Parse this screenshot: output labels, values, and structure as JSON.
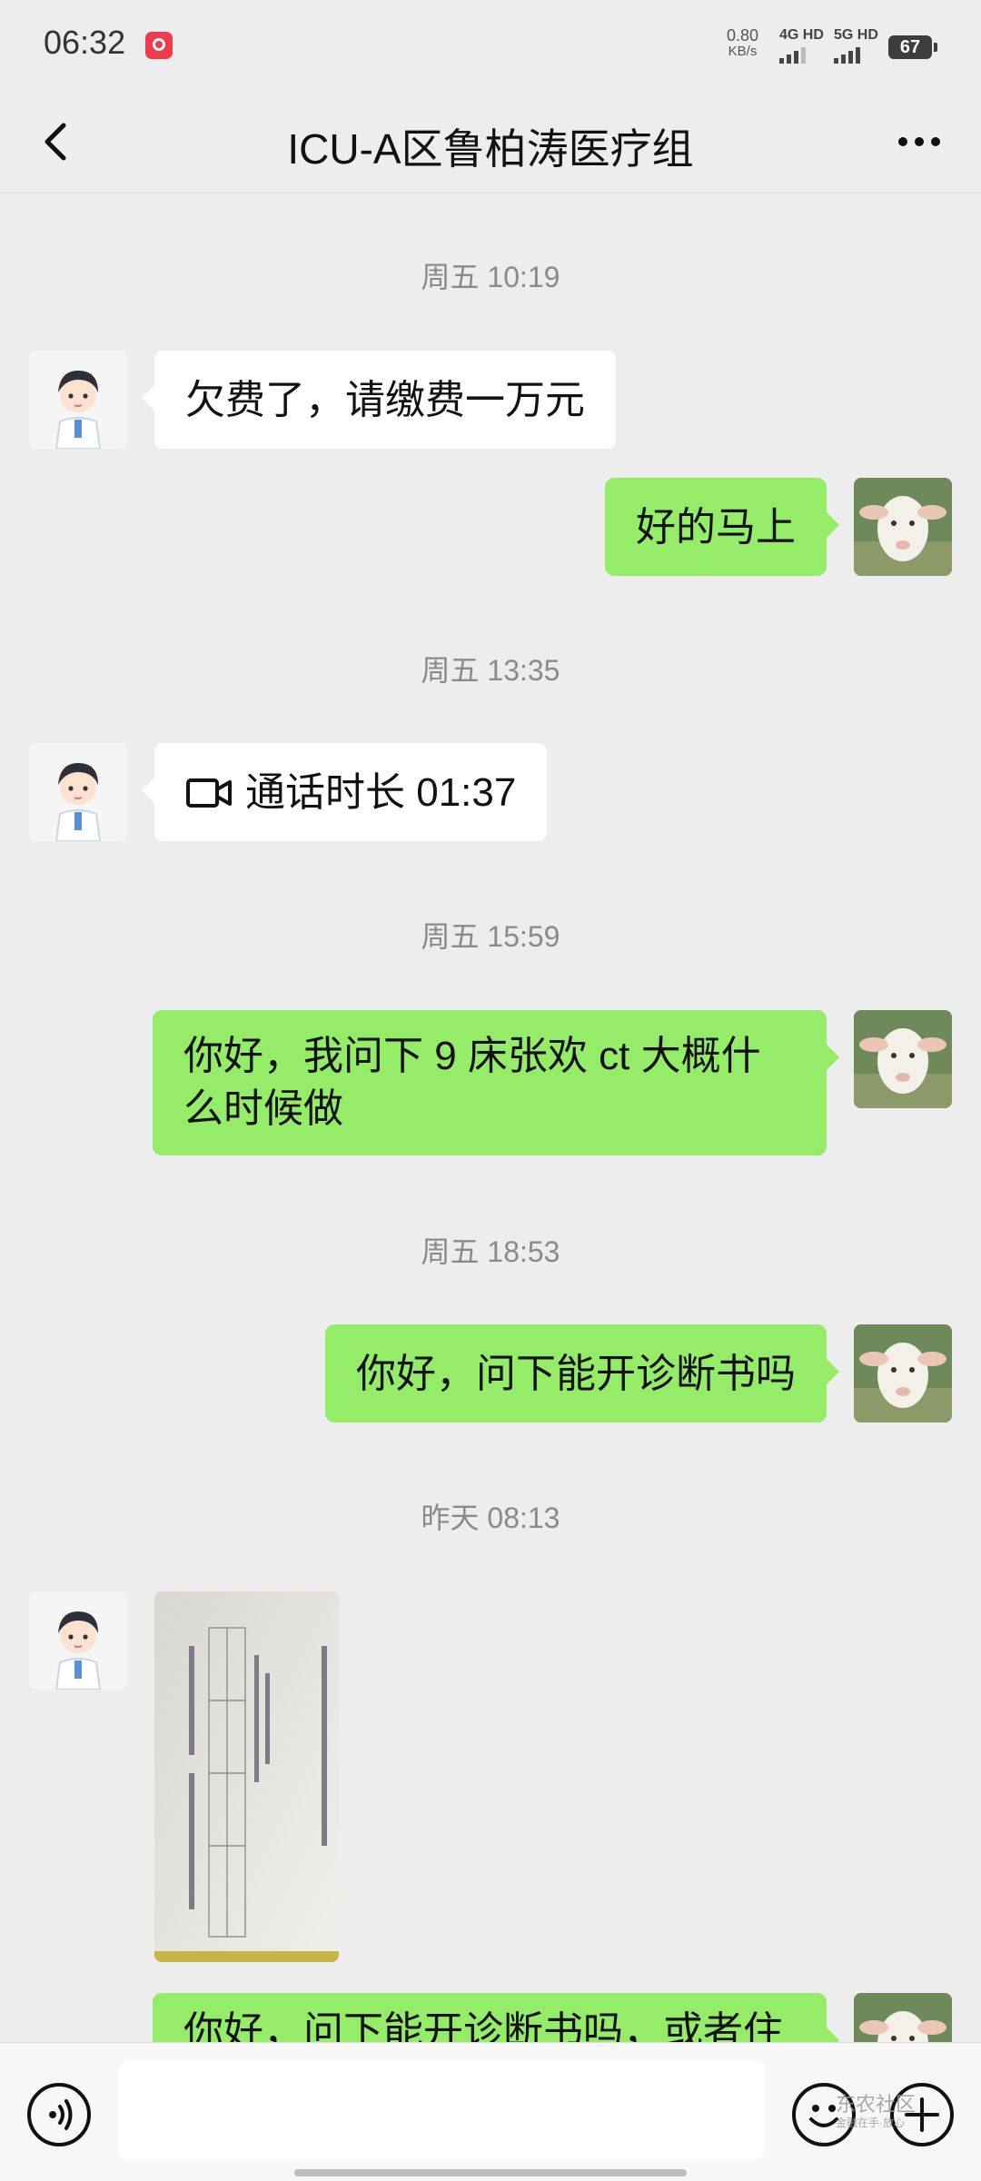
{
  "status_bar": {
    "time": "06:32",
    "net_speed": "0.80",
    "net_speed_unit": "KB/s",
    "signal_1": "4G HD",
    "signal_2": "5G HD",
    "battery": "67"
  },
  "header": {
    "title": "ICU-A区鲁柏涛医疗组"
  },
  "messages": {
    "ts1": "周五 10:19",
    "m1": "欠费了，请缴费一万元",
    "m2": "好的马上",
    "ts2": "周五 13:35",
    "m3_call": "通话时长 01:37",
    "ts3": "周五 15:59",
    "m4": "你好，我问下 9 床张欢 ct 大概什么时候做",
    "ts4": "周五 18:53",
    "m5": "你好，问下能开诊断书吗",
    "ts5": "昨天 08:13",
    "m7_partial": "你好，问下能开诊断书吗，或者住"
  },
  "input": {
    "placeholder": ""
  },
  "watermark": {
    "line1": "东农社区",
    "line2": "金融在手·放心"
  },
  "icons": [
    "back-icon",
    "more-icon",
    "video-call-icon",
    "voice-icon",
    "emoji-icon",
    "plus-icon"
  ],
  "colors": {
    "bubble_out": "#95ec69",
    "bubble_in": "#ffffff",
    "background": "#ededed"
  }
}
